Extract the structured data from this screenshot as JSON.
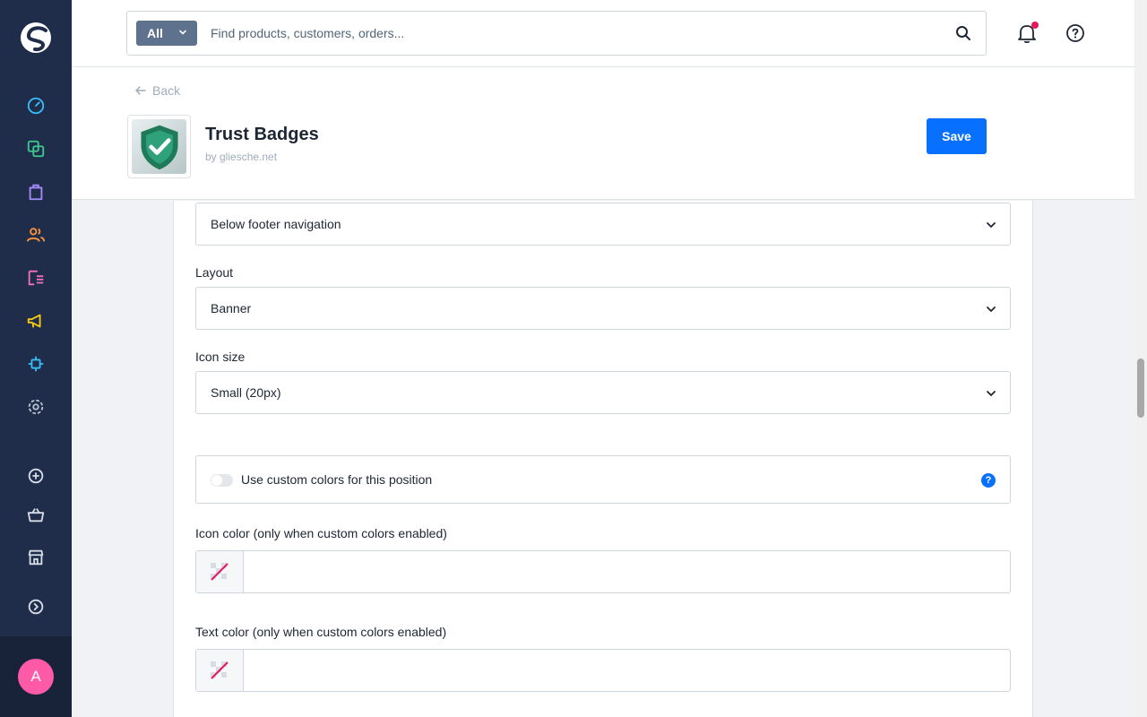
{
  "topbar": {
    "search_scope": "All",
    "search_placeholder": "Find products, customers, orders..."
  },
  "header": {
    "back_label": "Back",
    "app_title": "Trust Badges",
    "app_author": "by gliesche.net",
    "save_label": "Save"
  },
  "form": {
    "position_value": "Below footer navigation",
    "layout_label": "Layout",
    "layout_value": "Banner",
    "icon_size_label": "Icon size",
    "icon_size_value": "Small (20px)",
    "custom_colors_label": "Use custom colors for this position",
    "custom_colors_enabled": false,
    "help_glyph": "?",
    "icon_color_label": "Icon color (only when custom colors enabled)",
    "icon_color_value": "",
    "text_color_label": "Text color (only when custom colors enabled)",
    "text_color_value": ""
  },
  "user": {
    "avatar_initial": "A"
  },
  "colors": {
    "sidebar": "#1f2d4a",
    "primary": "#0870ff",
    "avatar": "#ff5aa8",
    "notification": "#e8175d"
  },
  "sidebar_icons": [
    "dashboard-icon",
    "catalogues-icon",
    "orders-icon",
    "customers-icon",
    "content-icon",
    "marketing-icon",
    "extensions-icon",
    "settings-icon",
    "add-icon",
    "basket-icon",
    "storefront-icon",
    "expand-icon"
  ]
}
